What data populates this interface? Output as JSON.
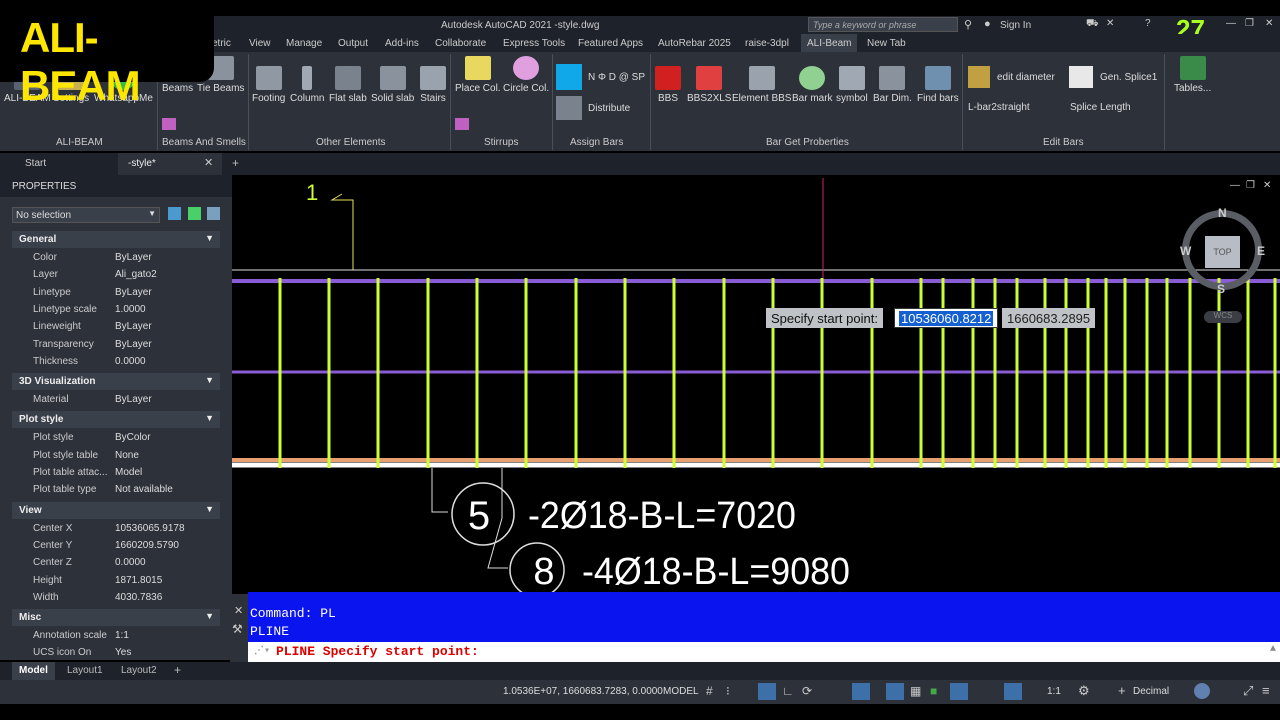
{
  "logo": {
    "text": "ALI-BEAM"
  },
  "title_bar": {
    "title": "Autodesk AutoCAD 2021    -style.dwg",
    "search_placeholder": "Type a keyword or phrase",
    "sign_in": "Sign In",
    "badge": "27"
  },
  "menu_tabs": [
    "etric",
    "View",
    "Manage",
    "Output",
    "Add-ins",
    "Collaborate",
    "Express Tools",
    "Featured Apps",
    "AutoRebar 2025",
    "raise-3dpl",
    "ALI-Beam",
    "New Tab"
  ],
  "ribbon": {
    "buttons": [
      "ALI-BEAM",
      "Settings",
      "WhatsappMe",
      "Beams",
      "Tie Beams",
      "Footing",
      "Column",
      "Flat slab",
      "Solid slab",
      "Stairs",
      "Place Col.",
      "Circle Col.",
      "Ν Φ D @ SP",
      "Distribute",
      "BBS",
      "BBS2XLS",
      "Element BBS",
      "Bar mark",
      "symbol",
      "Bar Dim.",
      "Find bars",
      "edit diameter",
      "Gen. Splice1",
      "L-bar2straight",
      "Splice Length",
      "Tables..."
    ],
    "panels": [
      "ALI-BEAM",
      "Beams And Smells",
      "Other Elements",
      "Stirrups",
      "Assign Bars",
      "Bar Get Proberties",
      "Edit Bars"
    ]
  },
  "file_tabs": [
    "Start",
    "-style*"
  ],
  "properties": {
    "title": "PROPERTIES",
    "selection": "No selection",
    "sections": {
      "general": "General",
      "viz": "3D Visualization",
      "plot": "Plot style",
      "view": "View",
      "misc": "Misc"
    },
    "general": [
      {
        "k": "Color",
        "v": "ByLayer"
      },
      {
        "k": "Layer",
        "v": "Ali_gato2"
      },
      {
        "k": "Linetype",
        "v": "ByLayer"
      },
      {
        "k": "Linetype scale",
        "v": "1.0000"
      },
      {
        "k": "Lineweight",
        "v": "ByLayer"
      },
      {
        "k": "Transparency",
        "v": "ByLayer"
      },
      {
        "k": "Thickness",
        "v": "0.0000"
      }
    ],
    "viz": [
      {
        "k": "Material",
        "v": "ByLayer"
      }
    ],
    "plot": [
      {
        "k": "Plot style",
        "v": "ByColor"
      },
      {
        "k": "Plot style table",
        "v": "None"
      },
      {
        "k": "Plot table attac...",
        "v": "Model"
      },
      {
        "k": "Plot table type",
        "v": "Not available"
      }
    ],
    "view": [
      {
        "k": "Center X",
        "v": "10536065.9178"
      },
      {
        "k": "Center Y",
        "v": "1660209.5790"
      },
      {
        "k": "Center Z",
        "v": "0.0000"
      },
      {
        "k": "Height",
        "v": "1871.8015"
      },
      {
        "k": "Width",
        "v": "4030.7836"
      }
    ],
    "misc": [
      {
        "k": "Annotation scale",
        "v": "1:1"
      },
      {
        "k": "UCS icon On",
        "v": "Yes"
      }
    ]
  },
  "canvas": {
    "mark_1": "1",
    "label_5": "5",
    "text_5": "-2Ø18-B-L=7020",
    "label_8": "8",
    "text_8": "-4Ø18-B-L=9080",
    "prompt": "Specify start point:",
    "x_value": "10536060.8212",
    "y_value": "1660683.2895",
    "viewcube": {
      "n": "N",
      "s": "S",
      "e": "E",
      "w": "W",
      "top": "TOP",
      "wcs": "WCS"
    }
  },
  "command": {
    "line1": "Command: PL",
    "line2": "PLINE",
    "prompt": "PLINE Specify start point:"
  },
  "layout_tabs": [
    "Model",
    "Layout1",
    "Layout2"
  ],
  "status": {
    "coords": "1.0536E+07, 1660683.7283, 0.0000",
    "model": "MODEL",
    "scale": "1:1",
    "units": "Decimal"
  },
  "colors": {
    "accent": "#ffe600",
    "rebar": "#ccff33",
    "purple": "#8a5cd6",
    "cmd_bg": "#0a14ee"
  }
}
